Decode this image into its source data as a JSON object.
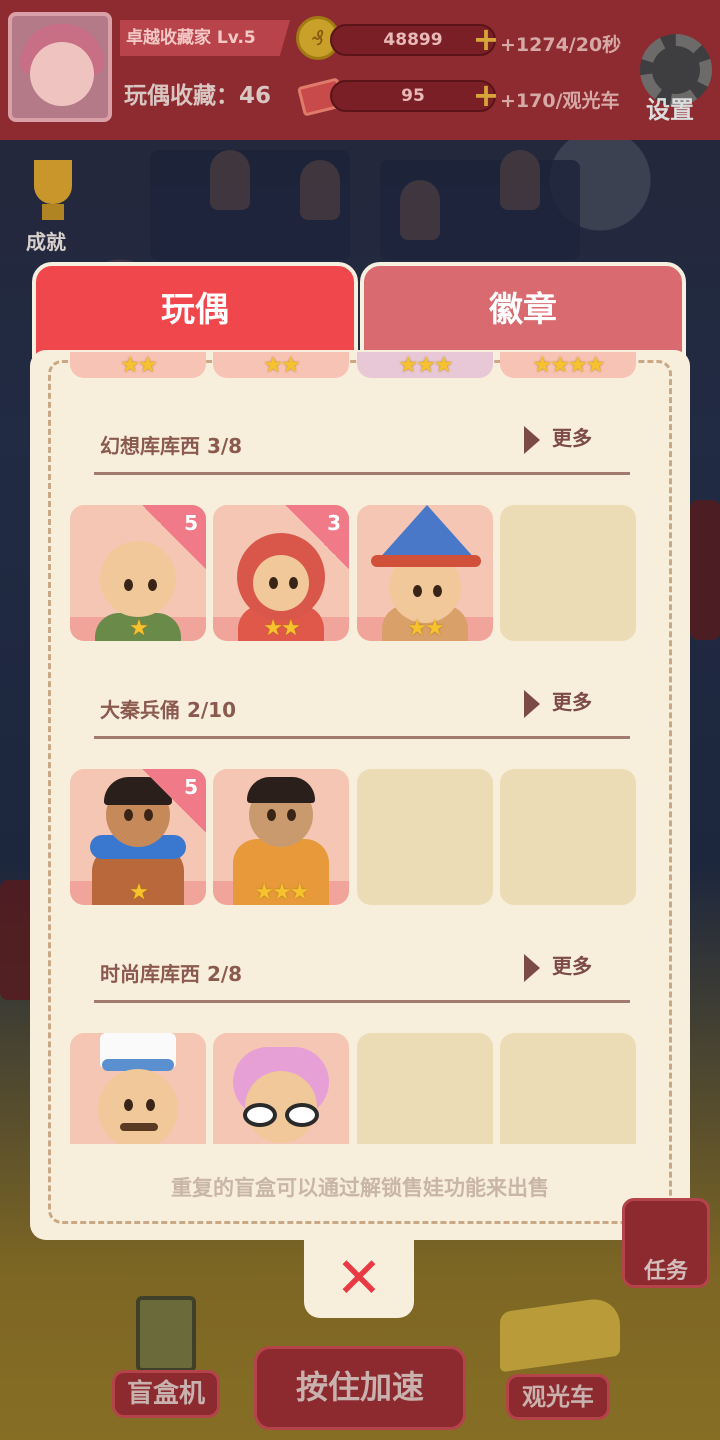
{
  "header": {
    "rank": "卓越收藏家 Lv.5",
    "collection_label": "玩偶收藏：46",
    "coins": "48899",
    "coin_rate": "+1274/20秒",
    "tickets": "95",
    "ticket_rate": "+170/观光车",
    "settings_label": "设置"
  },
  "side": {
    "achievement_label": "成就"
  },
  "tabs": [
    {
      "label": "玩偶",
      "active": true
    },
    {
      "label": "徽章",
      "active": false
    }
  ],
  "top_row_stars": [
    "★★",
    "★★",
    "★★★",
    "★★★★"
  ],
  "sections": [
    {
      "title": "幻想库库西 3/8",
      "more_label": "更多",
      "cards": [
        {
          "count": "5",
          "stars": "★"
        },
        {
          "count": "3",
          "stars": "★★"
        },
        {
          "count": "",
          "stars": "★★"
        }
      ]
    },
    {
      "title": "大秦兵俑 2/10",
      "more_label": "更多",
      "cards": [
        {
          "count": "5",
          "stars": "★"
        },
        {
          "count": "",
          "stars": "★★★"
        }
      ]
    },
    {
      "title": "时尚库库西 2/8",
      "more_label": "更多",
      "cards": [
        {
          "count": "",
          "stars": ""
        },
        {
          "count": "",
          "stars": ""
        }
      ]
    }
  ],
  "hint": "重复的盲盒可以通过解锁售娃功能来出售",
  "close_symbol": "✕",
  "bottom_bar": {
    "blind_box_machine": "盲盒机",
    "speed_up": "按住加速",
    "tour_bus": "观光车",
    "tasks": "任务"
  },
  "colors": {
    "active_tab": "#f0474c",
    "inactive_tab": "#d86a70",
    "panel": "#f8eedc",
    "card_filled": "#f5c6b4",
    "card_empty": "#ecdcb6",
    "star": "#f6c22e",
    "close_x": "#e83a44"
  },
  "icons": [
    "trophy-icon",
    "gold-coin-icon",
    "ticket-icon",
    "gear-icon",
    "play-arrow-icon",
    "close-icon",
    "star-icon"
  ]
}
